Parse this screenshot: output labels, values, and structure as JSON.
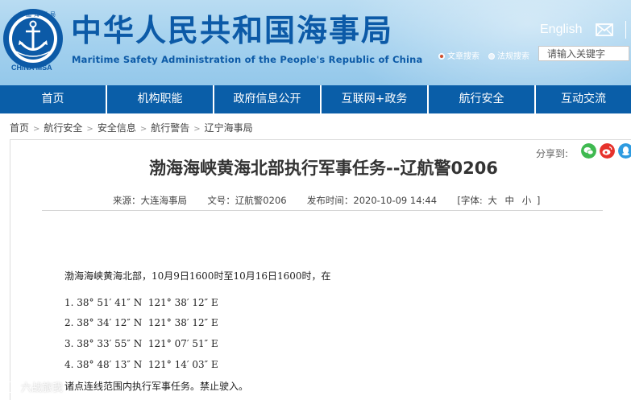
{
  "header": {
    "title_cn": "中华人民共和国海事局",
    "title_en": "Maritime Safety Administration of the People's Republic of China",
    "logo_text": "CHINA MSA",
    "logo_text_cn": "中国海事局",
    "lang_link": "English",
    "search": {
      "options": [
        {
          "label": "文章搜索",
          "selected": true
        },
        {
          "label": "法规搜索",
          "selected": false
        }
      ],
      "placeholder": "请输入关键字"
    }
  },
  "nav": {
    "items": [
      "首页",
      "机构职能",
      "政府信息公开",
      "互联网+政务",
      "航行安全",
      "互动交流"
    ]
  },
  "breadcrumb": {
    "items": [
      "首页",
      "航行安全",
      "安全信息",
      "航行警告",
      "辽宁海事局"
    ]
  },
  "article": {
    "share_label": "分享到:",
    "share_icons": [
      "wechat-icon",
      "weibo-icon",
      "qq-icon"
    ],
    "title": "渤海海峡黄海北部执行军事任务--辽航警0206",
    "meta": {
      "source_label": "来源：",
      "source": "大连海事局",
      "doc_label": "文号：",
      "doc_no": "辽航警0206",
      "date_label": "发布时间：",
      "date": "2020-10-09 14:44",
      "font_label": "[字体:",
      "font_sizes": [
        "大",
        "中",
        "小"
      ],
      "font_close": "]"
    },
    "intro": "渤海海峡黄海北部，10月9日1600时至10月16日1600时，在",
    "coordinates": [
      "1. 38° 51′ 41″ N  121° 38′ 12″ E",
      "2. 38° 34′ 12″ N  121° 38′ 12″ E",
      "3. 38° 33′ 55″ N  121° 07′ 51″ E",
      "4. 38° 48′ 13″ N  121° 14′ 03″ E"
    ],
    "closing": "诸点连线范围内执行军事任务。禁止驶入。"
  },
  "watermark": "六战旅我",
  "colors": {
    "brand_blue": "#0a5ea8",
    "title_blue": "#0c5aa7",
    "wechat_green": "#3fb950",
    "weibo_red": "#e6322c",
    "qq_blue": "#2e9be0"
  }
}
